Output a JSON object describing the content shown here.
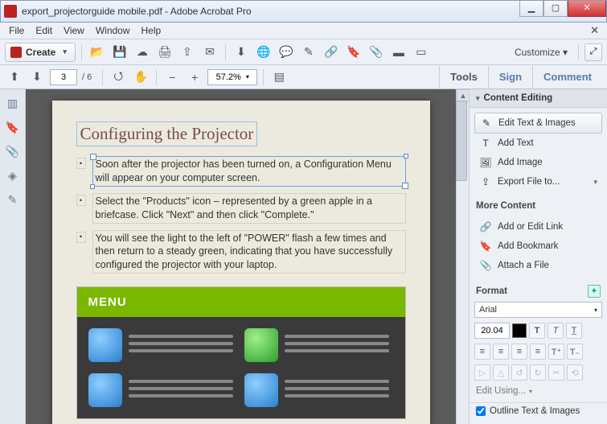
{
  "window": {
    "title": "export_projectorguide mobile.pdf - Adobe Acrobat Pro"
  },
  "menubar": {
    "items": [
      "File",
      "Edit",
      "View",
      "Window",
      "Help"
    ]
  },
  "toolbar": {
    "create_label": "Create",
    "customize_label": "Customize"
  },
  "nav": {
    "current_page": "3",
    "total_pages": "/ 6",
    "zoom": "57.2%"
  },
  "right_tabs": {
    "tools": "Tools",
    "sign": "Sign",
    "comment": "Comment"
  },
  "panel": {
    "head": "Content Editing",
    "edit_text_images": "Edit Text & Images",
    "add_text": "Add Text",
    "add_image": "Add Image",
    "export_file": "Export File to...",
    "more_content": "More Content",
    "add_edit_link": "Add or Edit Link",
    "add_bookmark": "Add Bookmark",
    "attach_file": "Attach a File",
    "format": "Format",
    "font": "Arial",
    "font_size": "20.04",
    "edit_using": "Edit Using...",
    "outline": "Outline Text & Images"
  },
  "doc": {
    "heading": "Configuring the Projector",
    "bullets": [
      "Soon after the projector has been turned on, a Configuration Menu will appear on your computer screen.",
      "Select the \"Products\" icon – represented by a green apple in a briefcase. Click \"Next\" and then click \"Complete.\"",
      "You will see the light to the left of \"POWER\" flash a few times and then return to a steady green, indicating that you have successfully configured the projector with your laptop."
    ],
    "menu_label": "MENU"
  }
}
